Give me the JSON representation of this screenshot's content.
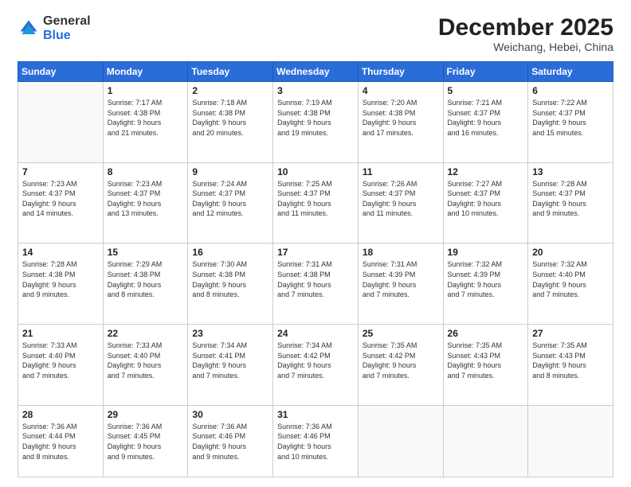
{
  "logo": {
    "general": "General",
    "blue": "Blue"
  },
  "title": {
    "month": "December 2025",
    "location": "Weichang, Hebei, China"
  },
  "weekdays": [
    "Sunday",
    "Monday",
    "Tuesday",
    "Wednesday",
    "Thursday",
    "Friday",
    "Saturday"
  ],
  "weeks": [
    [
      {
        "day": "",
        "info": ""
      },
      {
        "day": "1",
        "info": "Sunrise: 7:17 AM\nSunset: 4:38 PM\nDaylight: 9 hours\nand 21 minutes."
      },
      {
        "day": "2",
        "info": "Sunrise: 7:18 AM\nSunset: 4:38 PM\nDaylight: 9 hours\nand 20 minutes."
      },
      {
        "day": "3",
        "info": "Sunrise: 7:19 AM\nSunset: 4:38 PM\nDaylight: 9 hours\nand 19 minutes."
      },
      {
        "day": "4",
        "info": "Sunrise: 7:20 AM\nSunset: 4:38 PM\nDaylight: 9 hours\nand 17 minutes."
      },
      {
        "day": "5",
        "info": "Sunrise: 7:21 AM\nSunset: 4:37 PM\nDaylight: 9 hours\nand 16 minutes."
      },
      {
        "day": "6",
        "info": "Sunrise: 7:22 AM\nSunset: 4:37 PM\nDaylight: 9 hours\nand 15 minutes."
      }
    ],
    [
      {
        "day": "7",
        "info": "Sunrise: 7:23 AM\nSunset: 4:37 PM\nDaylight: 9 hours\nand 14 minutes."
      },
      {
        "day": "8",
        "info": "Sunrise: 7:23 AM\nSunset: 4:37 PM\nDaylight: 9 hours\nand 13 minutes."
      },
      {
        "day": "9",
        "info": "Sunrise: 7:24 AM\nSunset: 4:37 PM\nDaylight: 9 hours\nand 12 minutes."
      },
      {
        "day": "10",
        "info": "Sunrise: 7:25 AM\nSunset: 4:37 PM\nDaylight: 9 hours\nand 11 minutes."
      },
      {
        "day": "11",
        "info": "Sunrise: 7:26 AM\nSunset: 4:37 PM\nDaylight: 9 hours\nand 11 minutes."
      },
      {
        "day": "12",
        "info": "Sunrise: 7:27 AM\nSunset: 4:37 PM\nDaylight: 9 hours\nand 10 minutes."
      },
      {
        "day": "13",
        "info": "Sunrise: 7:28 AM\nSunset: 4:37 PM\nDaylight: 9 hours\nand 9 minutes."
      }
    ],
    [
      {
        "day": "14",
        "info": "Sunrise: 7:28 AM\nSunset: 4:38 PM\nDaylight: 9 hours\nand 9 minutes."
      },
      {
        "day": "15",
        "info": "Sunrise: 7:29 AM\nSunset: 4:38 PM\nDaylight: 9 hours\nand 8 minutes."
      },
      {
        "day": "16",
        "info": "Sunrise: 7:30 AM\nSunset: 4:38 PM\nDaylight: 9 hours\nand 8 minutes."
      },
      {
        "day": "17",
        "info": "Sunrise: 7:31 AM\nSunset: 4:38 PM\nDaylight: 9 hours\nand 7 minutes."
      },
      {
        "day": "18",
        "info": "Sunrise: 7:31 AM\nSunset: 4:39 PM\nDaylight: 9 hours\nand 7 minutes."
      },
      {
        "day": "19",
        "info": "Sunrise: 7:32 AM\nSunset: 4:39 PM\nDaylight: 9 hours\nand 7 minutes."
      },
      {
        "day": "20",
        "info": "Sunrise: 7:32 AM\nSunset: 4:40 PM\nDaylight: 9 hours\nand 7 minutes."
      }
    ],
    [
      {
        "day": "21",
        "info": "Sunrise: 7:33 AM\nSunset: 4:40 PM\nDaylight: 9 hours\nand 7 minutes."
      },
      {
        "day": "22",
        "info": "Sunrise: 7:33 AM\nSunset: 4:40 PM\nDaylight: 9 hours\nand 7 minutes."
      },
      {
        "day": "23",
        "info": "Sunrise: 7:34 AM\nSunset: 4:41 PM\nDaylight: 9 hours\nand 7 minutes."
      },
      {
        "day": "24",
        "info": "Sunrise: 7:34 AM\nSunset: 4:42 PM\nDaylight: 9 hours\nand 7 minutes."
      },
      {
        "day": "25",
        "info": "Sunrise: 7:35 AM\nSunset: 4:42 PM\nDaylight: 9 hours\nand 7 minutes."
      },
      {
        "day": "26",
        "info": "Sunrise: 7:35 AM\nSunset: 4:43 PM\nDaylight: 9 hours\nand 7 minutes."
      },
      {
        "day": "27",
        "info": "Sunrise: 7:35 AM\nSunset: 4:43 PM\nDaylight: 9 hours\nand 8 minutes."
      }
    ],
    [
      {
        "day": "28",
        "info": "Sunrise: 7:36 AM\nSunset: 4:44 PM\nDaylight: 9 hours\nand 8 minutes."
      },
      {
        "day": "29",
        "info": "Sunrise: 7:36 AM\nSunset: 4:45 PM\nDaylight: 9 hours\nand 9 minutes."
      },
      {
        "day": "30",
        "info": "Sunrise: 7:36 AM\nSunset: 4:46 PM\nDaylight: 9 hours\nand 9 minutes."
      },
      {
        "day": "31",
        "info": "Sunrise: 7:36 AM\nSunset: 4:46 PM\nDaylight: 9 hours\nand 10 minutes."
      },
      {
        "day": "",
        "info": ""
      },
      {
        "day": "",
        "info": ""
      },
      {
        "day": "",
        "info": ""
      }
    ]
  ]
}
